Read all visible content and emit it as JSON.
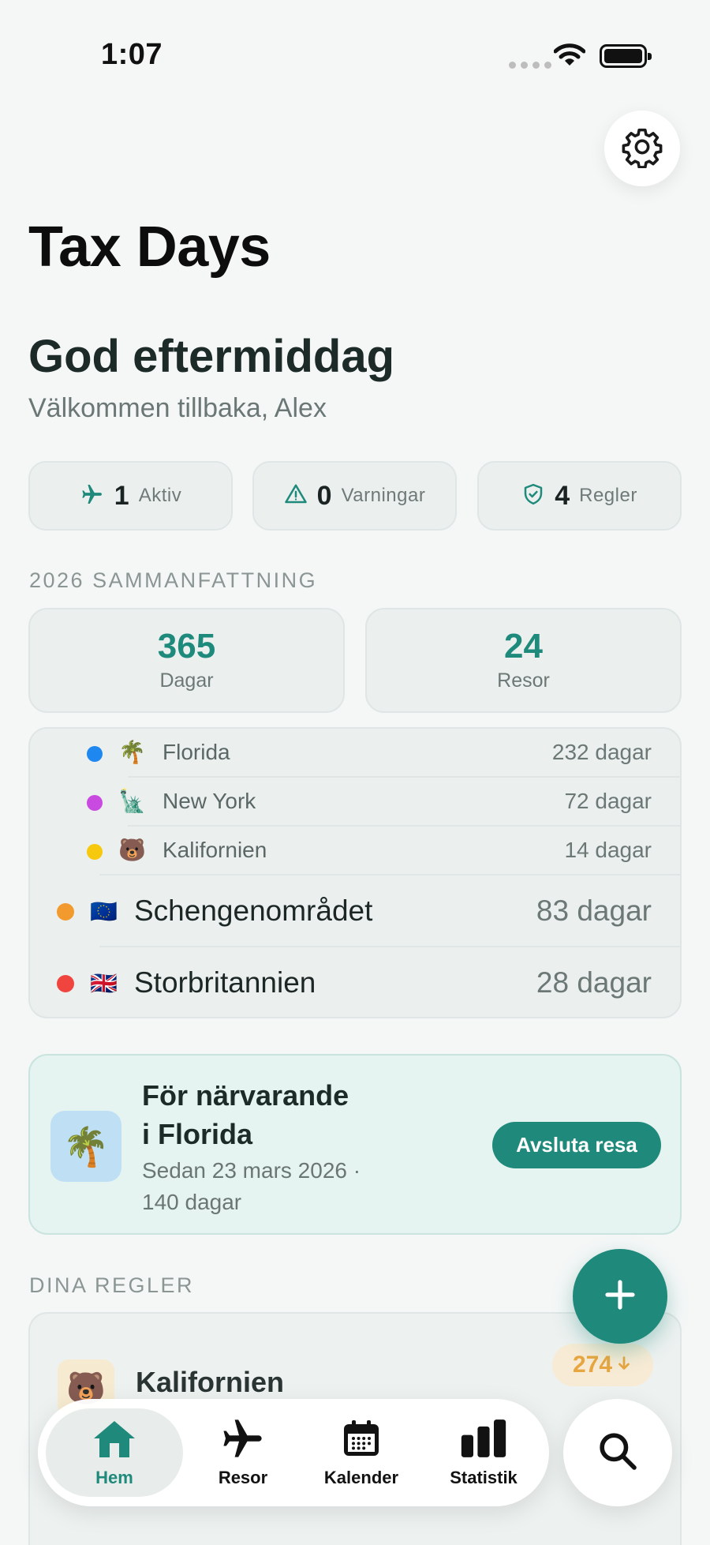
{
  "status_bar": {
    "time": "1:07"
  },
  "app": {
    "title": "Tax Days"
  },
  "greeting": {
    "title": "God eftermiddag",
    "subtitle": "Välkommen tillbaka, Alex"
  },
  "stats": [
    {
      "icon": "airplane-icon",
      "value": "1",
      "label": "Aktiv"
    },
    {
      "icon": "warning-icon",
      "value": "0",
      "label": "Varningar"
    },
    {
      "icon": "shield-icon",
      "value": "4",
      "label": "Regler"
    }
  ],
  "summary": {
    "section_label": "2026 SAMMANFATTNING",
    "days": {
      "value": "365",
      "label": "Dagar"
    },
    "trips": {
      "value": "24",
      "label": "Resor"
    }
  },
  "breakdown": [
    {
      "name": "Florida",
      "days": "232 dagar",
      "emoji": "🌴",
      "color": "#1e88f0"
    },
    {
      "name": "New York",
      "days": "72 dagar",
      "emoji": "🗽",
      "color": "#c94ae0"
    },
    {
      "name": "Kalifornien",
      "days": "14 dagar",
      "emoji": "🐻",
      "color": "#f6c90e"
    },
    {
      "name": "Schengenområdet",
      "days": "83 dagar",
      "emoji": "🇪🇺",
      "color": "#f39a2e"
    },
    {
      "name": "Storbritannien",
      "days": "28 dagar",
      "emoji": "🇬🇧",
      "color": "#f0453e"
    }
  ],
  "current": {
    "emoji": "🌴",
    "title_line1": "För närvarande",
    "title_line2": "i Florida",
    "since_line1": "Sedan 23 mars 2026 ·",
    "since_line2": "140 dagar",
    "end_button": "Avsluta resa"
  },
  "rules": {
    "section_label": "DINA REGLER",
    "items": [
      {
        "emoji": "🐻",
        "name": "Kalifornien",
        "badge": "274"
      }
    ]
  },
  "tabs": [
    {
      "label": "Hem",
      "icon": "home-icon",
      "active": true
    },
    {
      "label": "Resor",
      "icon": "airplane-icon"
    },
    {
      "label": "Kalender",
      "icon": "calendar-icon"
    },
    {
      "label": "Statistik",
      "icon": "chart-icon"
    }
  ],
  "colors": {
    "accent": "#1f8a7b",
    "warning": "#e8a640"
  }
}
